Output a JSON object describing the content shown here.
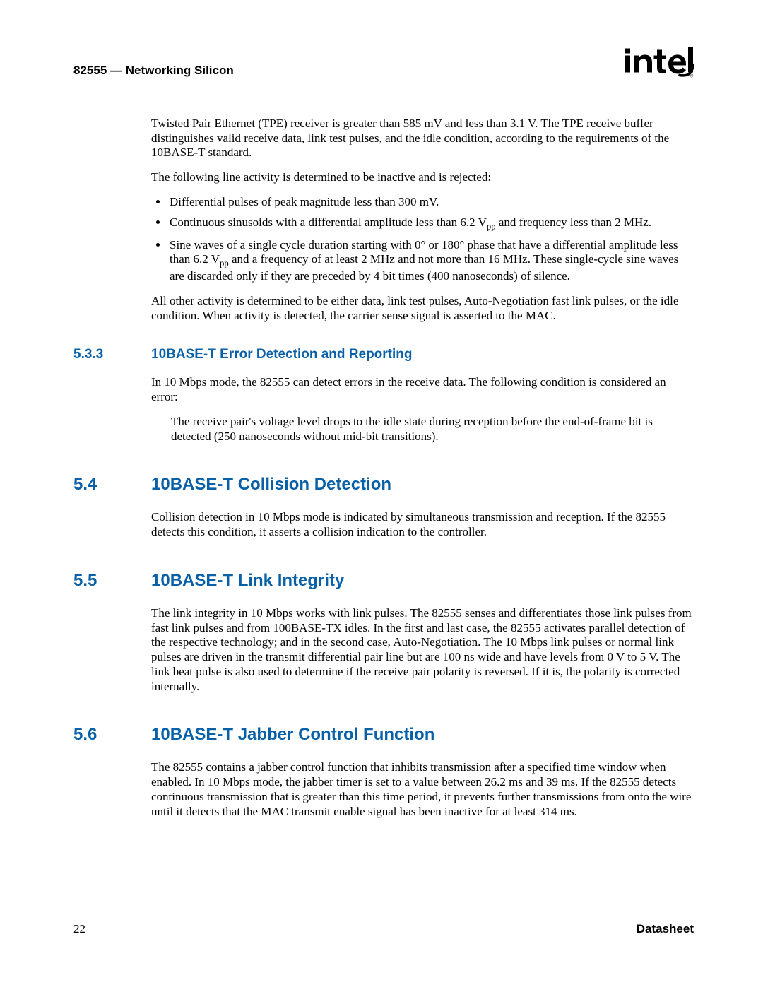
{
  "header": {
    "left": "82555 — Networking Silicon",
    "logo_name": "intel-logo"
  },
  "intro": {
    "p1": "Twisted Pair Ethernet (TPE) receiver is greater than 585 mV and less than 3.1 V. The TPE receive buffer distinguishes valid receive data, link test pulses, and the idle condition, according to the requirements of the 10BASE-T standard.",
    "p2": "The following line activity is determined to be inactive and is rejected:",
    "bullets": {
      "b1": "Differential pulses of peak magnitude less than 300 mV.",
      "b2a": "Continuous sinusoids with a differential amplitude less than 6.2 V",
      "b2b": " and frequency less than 2 MHz.",
      "b3a": "Sine waves of a single cycle duration starting with 0° or 180° phase that have a differential amplitude less than 6.2 V",
      "b3b": " and a frequency of at least 2 MHz and not more than 16 MHz. These single-cycle sine waves are discarded only if they are preceded by 4 bit times (400 nanoseconds) of silence.",
      "sub": "pp"
    },
    "p3": "All other activity is determined to be either data, link test pulses, Auto-Negotiation fast link pulses, or the idle condition. When activity is detected, the carrier sense signal is asserted to the MAC."
  },
  "s533": {
    "num": "5.3.3",
    "title": "10BASE-T Error Detection and Reporting",
    "p1": "In 10 Mbps mode, the 82555 can detect errors in the receive data. The following condition is considered an error:",
    "p2": "The receive pair's voltage level drops to the idle state during reception before the end-of-frame bit is detected (250 nanoseconds without mid-bit transitions)."
  },
  "s54": {
    "num": "5.4",
    "title": "10BASE-T Collision Detection",
    "p1": "Collision detection in 10 Mbps mode is indicated by simultaneous transmission and reception. If the 82555 detects this condition, it asserts a collision indication to the controller."
  },
  "s55": {
    "num": "5.5",
    "title": "10BASE-T Link Integrity",
    "p1": "The link integrity in 10 Mbps works with link pulses. The 82555 senses and differentiates those link pulses from fast link pulses and from 100BASE-TX idles. In the first and last case, the 82555 activates parallel detection of the respective technology; and in the second case, Auto-Negotiation. The 10 Mbps link pulses or normal link pulses are driven in the transmit differential pair line but are 100 ns wide and have levels from 0 V to 5 V. The link beat pulse is also used to determine if the receive pair polarity is reversed. If it is, the polarity is corrected internally."
  },
  "s56": {
    "num": "5.6",
    "title": "10BASE-T Jabber Control Function",
    "p1": "The 82555 contains a jabber control function that inhibits transmission after a specified time window when enabled. In 10 Mbps mode, the jabber timer is set to a value between 26.2 ms and 39 ms. If the 82555 detects continuous transmission that is greater than this time period, it prevents further transmissions from onto the wire until it detects that the MAC transmit enable signal has been inactive for at least 314 ms."
  },
  "footer": {
    "page": "22",
    "label": "Datasheet"
  }
}
